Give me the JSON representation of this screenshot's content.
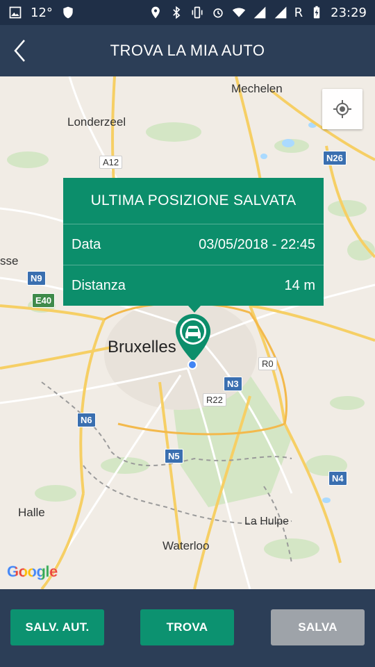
{
  "status_bar": {
    "temperature": "12°",
    "carrier": "R",
    "time": "23:29"
  },
  "app_bar": {
    "title": "TROVA LA MIA AUTO"
  },
  "map": {
    "places": {
      "mechelen": "Mechelen",
      "londerzeel": "Londerzeel",
      "asse": "sse",
      "bruxelles": "Bruxelles",
      "halle": "Halle",
      "la_hulpe": "La Hulpe",
      "waterloo": "Waterloo"
    },
    "roads": {
      "a12": "A12",
      "n26": "N26",
      "n9": "N9",
      "e40": "E40",
      "r0": "R0",
      "n3": "N3",
      "r22": "R22",
      "n6": "N6",
      "n5": "N5",
      "n4": "N4"
    },
    "attribution": "Google"
  },
  "popup": {
    "title": "ULTIMA POSIZIONE SALVATA",
    "date_label": "Data",
    "date_value": "03/05/2018 - 22:45",
    "distance_label": "Distanza",
    "distance_value": "14 m"
  },
  "buttons": {
    "salv_aut": "SALV. AUT.",
    "trova": "TROVA",
    "salva": "SALVA"
  },
  "colors": {
    "accent": "#0c8e6b",
    "header": "#2c3e57",
    "disabled": "#9ea3a9"
  }
}
